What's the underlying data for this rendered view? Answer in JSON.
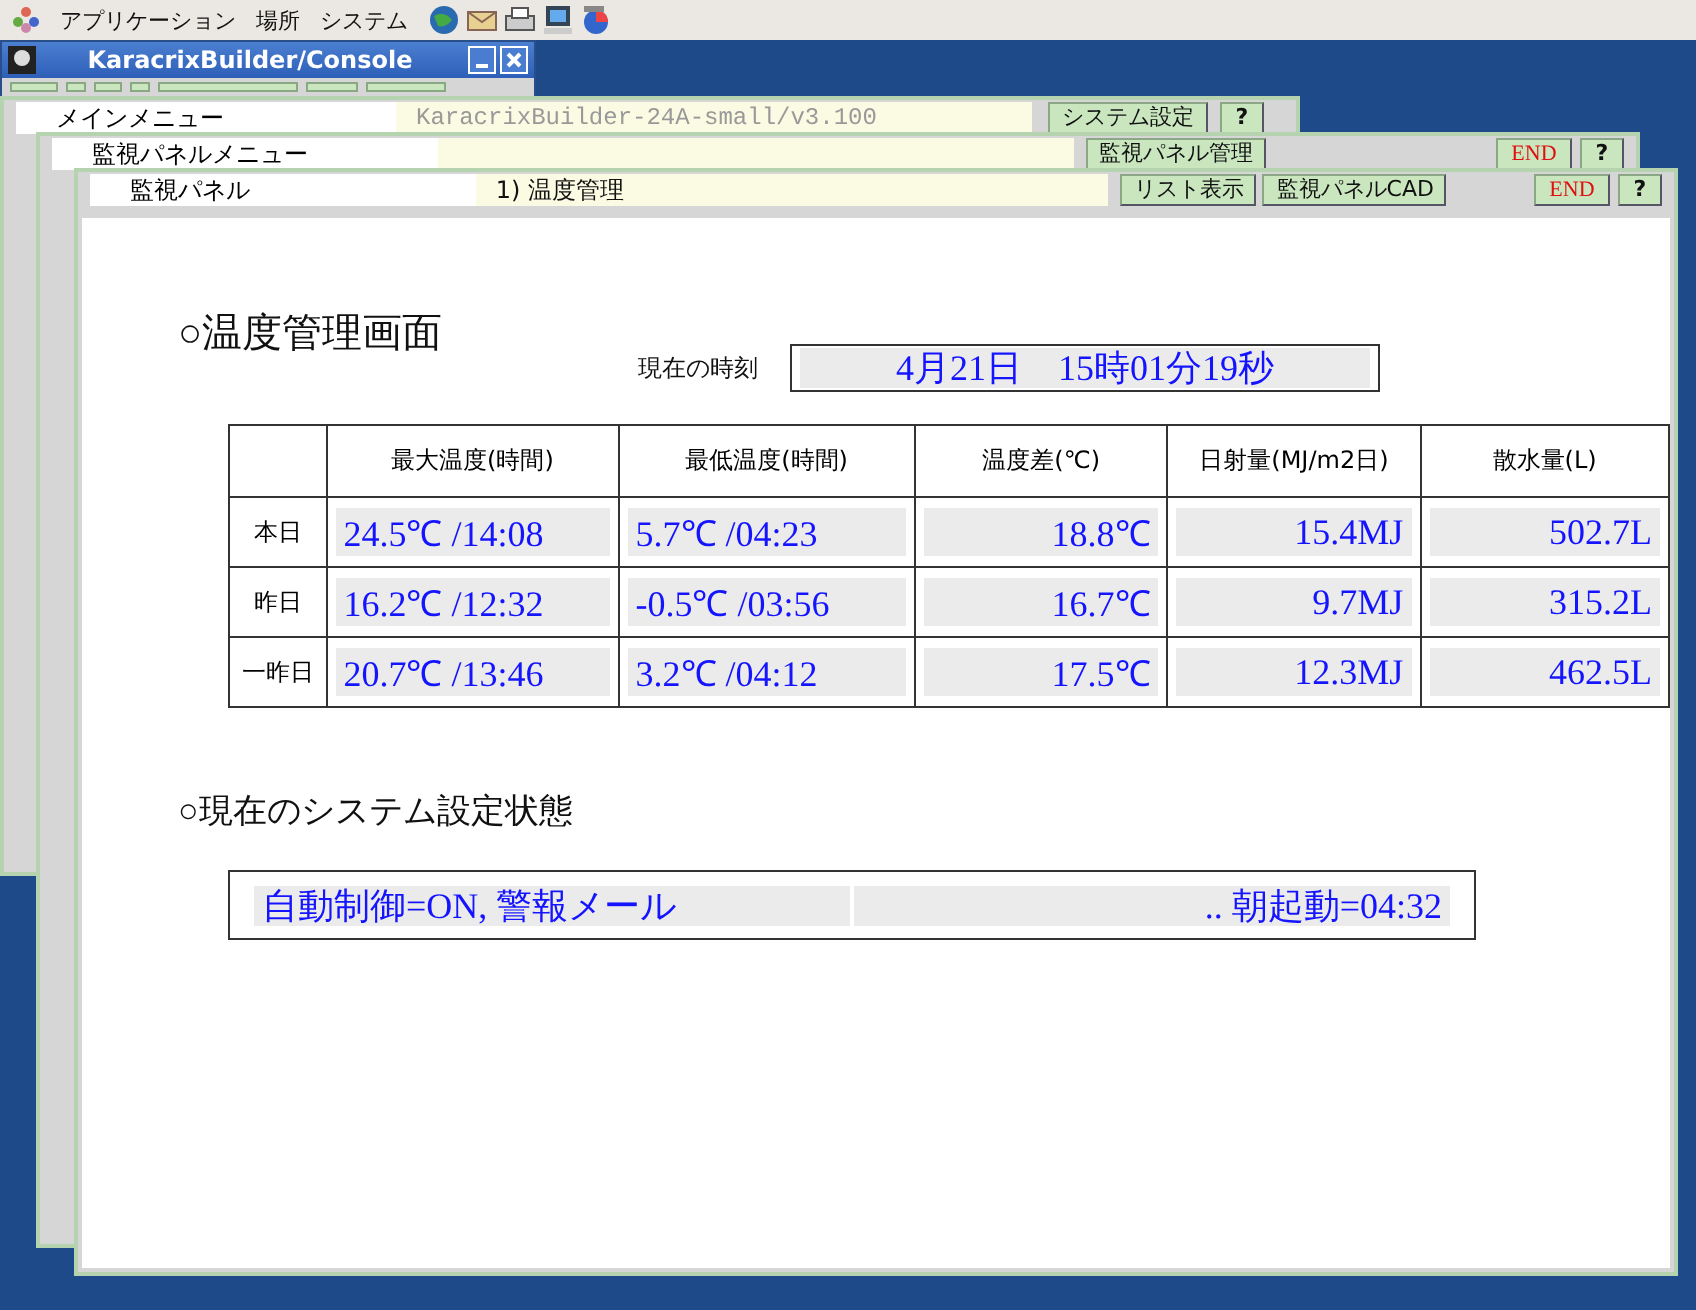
{
  "top_panel": {
    "menus": [
      "アプリケーション",
      "場所",
      "システム"
    ]
  },
  "console_window": {
    "title": "KaracrixBuilder/Console"
  },
  "windows": [
    {
      "name": "メインメニュー",
      "info": "KaracrixBuilder-24A-small/v3.100",
      "buttons": [
        {
          "label": "システム設定",
          "kind": "normal"
        },
        {
          "label": "?",
          "kind": "help"
        }
      ]
    },
    {
      "name": "監視パネルメニュー",
      "buttons": [
        {
          "label": "監視パネル管理",
          "kind": "normal"
        },
        {
          "label": "END",
          "kind": "end"
        },
        {
          "label": "?",
          "kind": "help"
        }
      ]
    },
    {
      "name": "監視パネル",
      "info": "1) 温度管理",
      "buttons": [
        {
          "label": "リスト表示",
          "kind": "normal"
        },
        {
          "label": "監視パネルCAD",
          "kind": "normal"
        },
        {
          "label": "END",
          "kind": "end"
        },
        {
          "label": "?",
          "kind": "help"
        }
      ]
    }
  ],
  "panel": {
    "heading": "○温度管理画面",
    "clock_label": "現在の時刻",
    "clock": "4月21日　15時01分19秒",
    "table": {
      "columns": [
        "最大温度(時間)",
        "最低温度(時間)",
        "温度差(℃)",
        "日射量(MJ/m2日)",
        "散水量(L)"
      ],
      "rows": [
        {
          "label": "本日",
          "cells": [
            "24.5℃ /14:08",
            "5.7℃ /04:23",
            "18.8℃",
            "15.4MJ",
            "502.7L"
          ]
        },
        {
          "label": "昨日",
          "cells": [
            "16.2℃ /12:32",
            "-0.5℃ /03:56",
            "16.7℃",
            "9.7MJ",
            "315.2L"
          ]
        },
        {
          "label": "一昨日",
          "cells": [
            "20.7℃ /13:46",
            "3.2℃ /04:12",
            "17.5℃",
            "12.3MJ",
            "462.5L"
          ]
        }
      ]
    },
    "status_heading": "○現在のシステム設定状態",
    "status": [
      "自動制御=ON, 警報メール",
      ".. 朝起動=04:32"
    ]
  }
}
